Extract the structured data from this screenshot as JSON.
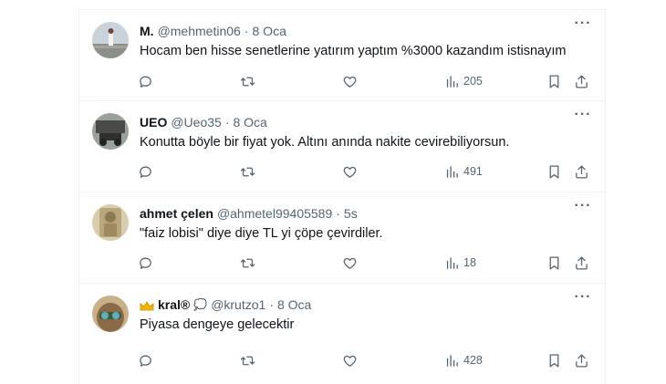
{
  "tweets": [
    {
      "name": "M.",
      "handle": "@mehmetin06",
      "dot": "·",
      "time": "8 Oca",
      "text": "Hocam ben hisse senetlerine yatırım yaptım %3000 kazandım istisnayım",
      "views": "205"
    },
    {
      "name": "UEO",
      "handle": "@Ueo35",
      "dot": "·",
      "time": "8 Oca",
      "text": "Konutta böyle bir fiyat yok. Altını anında nakite cevirebiliyorsun.",
      "views": "491"
    },
    {
      "name": "ahmet çelen",
      "handle": "@ahmetel99405589",
      "dot": "·",
      "time": "5s",
      "text": "\"faiz lobisi\" diye diye TL yi çöpe çevirdiler.",
      "views": "18"
    },
    {
      "name": "kral®",
      "badge": "💭",
      "handle": "@krutzo1",
      "dot": "·",
      "time": "8 Oca",
      "text": "Piyasa dengeye gelecektir",
      "views": "428"
    }
  ],
  "icons": {
    "reply": "reply-icon",
    "retweet": "retweet-icon",
    "like": "heart-icon",
    "views": "views-icon",
    "bookmark": "bookmark-icon",
    "share": "share-icon",
    "more": "more-icon"
  },
  "colors": {
    "text": "#0f1419",
    "muted": "#536471",
    "border": "#eff3f4"
  }
}
